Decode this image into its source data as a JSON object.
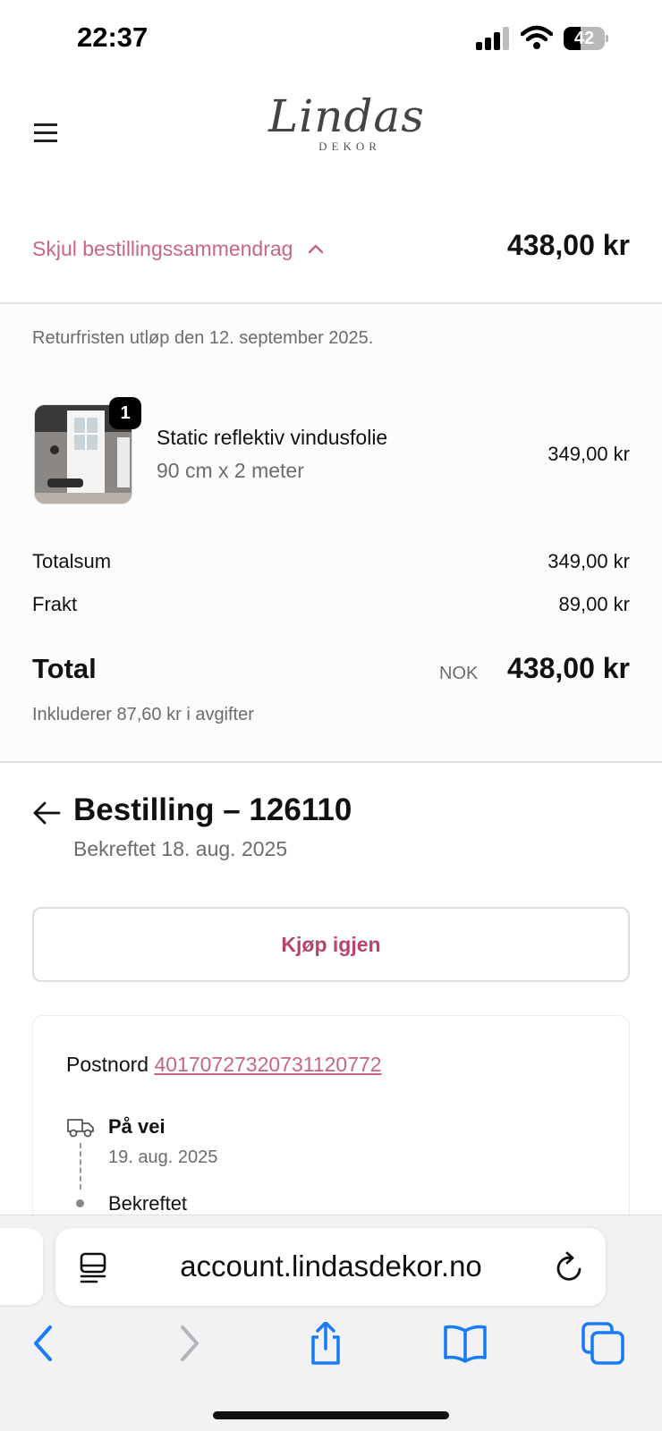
{
  "status_bar": {
    "time": "22:37",
    "battery": "42",
    "battery_level_percent": 42,
    "icons": [
      "signal-icon",
      "wifi-icon",
      "battery-icon"
    ]
  },
  "header": {
    "logo_script": "Lindas",
    "logo_sub": "DEKOR",
    "menu_icon": "hamburger-menu-icon"
  },
  "summary": {
    "toggle_label": "Skjul bestillingssammendrag",
    "toggle_icon": "chevron-up-icon",
    "total": "438,00 kr",
    "return_note": "Returfristen utløp den 12. september 2025.",
    "product": {
      "quantity": "1",
      "name": "Static reflektiv vindusfolie",
      "variant": "90 cm x 2 meter",
      "price": "349,00 kr"
    },
    "subtotal_label": "Totalsum",
    "subtotal_value": "349,00 kr",
    "shipping_label": "Frakt",
    "shipping_value": "89,00 kr",
    "total_label": "Total",
    "currency": "NOK",
    "total_value": "438,00 kr",
    "taxes_note": "Inkluderer 87,60 kr i avgifter"
  },
  "order": {
    "title": "Bestilling – 126110",
    "confirmed_date": "Bekreftet 18. aug. 2025",
    "buy_again": "Kjøp igjen",
    "carrier": "Postnord",
    "tracking_number": "40170727320731120772",
    "timeline": [
      {
        "status": "På vei",
        "date": "19. aug. 2025",
        "icon": "truck-icon"
      },
      {
        "status": "Bekreftet",
        "date": "",
        "icon": "dot-icon"
      }
    ]
  },
  "browser": {
    "url": "account.lindasdekor.no",
    "toolbar": [
      "back-icon",
      "forward-icon",
      "share-icon",
      "bookmarks-icon",
      "tabs-icon"
    ]
  },
  "colors": {
    "accent_pink": "#c8648a",
    "button_text": "#b8436e",
    "ios_blue": "#1a7cf5"
  }
}
